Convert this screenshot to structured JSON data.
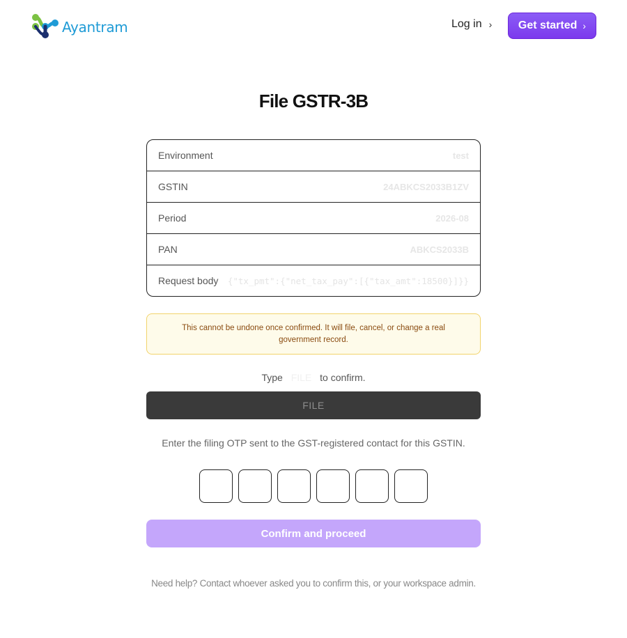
{
  "header": {
    "brand": "Ayantram",
    "login_label": "Log in",
    "get_started_label": "Get started",
    "chevron": "›",
    "accent": "#7c3aed"
  },
  "page_title": "File GSTR-3B",
  "details": {
    "rows": [
      {
        "label": "Environment",
        "value": "test"
      },
      {
        "label": "GSTIN",
        "value": "24ABKCS2033B1ZV"
      },
      {
        "label": "Period",
        "value": "2026-08"
      },
      {
        "label": "PAN",
        "value": "ABKCS2033B"
      },
      {
        "label": "Request body",
        "value": "{\"tx_pmt\":{\"net_tax_pay\":[{\"tax_amt\":18500}]}}"
      }
    ]
  },
  "warning": {
    "text": "This cannot be undone once confirmed. It will file, cancel, or change a real government record.",
    "border_color": "#f2d36b",
    "bg_color": "#fefbea"
  },
  "type_confirm": {
    "prefix": "Type",
    "word": "FILE",
    "suffix": "to confirm."
  },
  "file_button_label": "FILE",
  "otp": {
    "instruction": "Enter the filing OTP sent to the GST-registered contact for this GSTIN.",
    "digits": 6
  },
  "confirm_button_label": "Confirm and proceed",
  "help_text": "Need help? Contact whoever asked you to confirm this, or your workspace admin."
}
